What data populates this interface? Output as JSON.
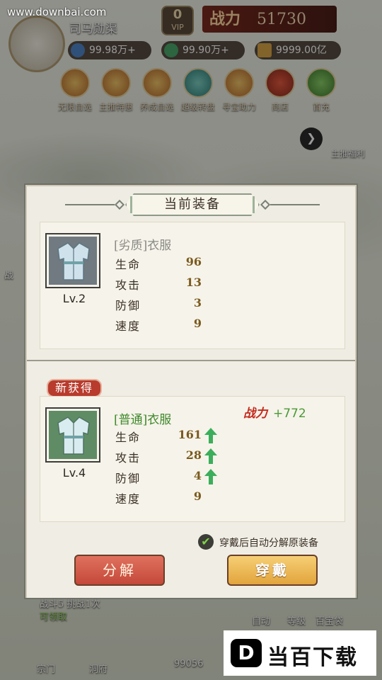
{
  "top_bar": {
    "site_watermark": "www.downbai.com",
    "player_name": "司马勋渠",
    "vip_label": "VIP",
    "vip_level": "0",
    "power_label": "战力",
    "power_value": "51730",
    "resources": [
      {
        "icon": "blue-gem-icon",
        "value": "99.98万+"
      },
      {
        "icon": "green-jade-icon",
        "value": "99.90万+"
      },
      {
        "icon": "scroll-icon",
        "value": "9999.00亿"
      }
    ]
  },
  "function_icons": [
    "无限自选",
    "主推特惠",
    "养成自选",
    "超级转盘",
    "寻宝助力",
    "商店",
    "首充"
  ],
  "side": {
    "arrow": "❯",
    "label": "主推福利"
  },
  "background_bottom": {
    "left_text_1": "战",
    "quest_text": "战斗5 挑战1次",
    "quest_status": "可领取",
    "nav_1": "宗门",
    "nav_2": "洞府",
    "counter": "99056",
    "right_1": "自动",
    "right_2": "等级",
    "right_3": "百宝袋"
  },
  "modal": {
    "title": "当前装备",
    "current": {
      "quality": "[劣质]",
      "name": "衣服",
      "level": "Lv.2",
      "stats": [
        {
          "label": "生命",
          "value": "96"
        },
        {
          "label": "攻击",
          "value": "13"
        },
        {
          "label": "防御",
          "value": "3"
        },
        {
          "label": "速度",
          "value": "9"
        }
      ]
    },
    "new_tag": "新获得",
    "new_item": {
      "quality": "[普通]",
      "name": "衣服",
      "level": "Lv.4",
      "power_label": "战力",
      "power_delta": "+772",
      "stats": [
        {
          "label": "生命",
          "value": "161",
          "up": true
        },
        {
          "label": "攻击",
          "value": "28",
          "up": true
        },
        {
          "label": "防御",
          "value": "4",
          "up": true
        },
        {
          "label": "速度",
          "value": "9",
          "up": false
        }
      ]
    },
    "auto_decompose_label": "穿戴后自动分解原装备",
    "auto_decompose_checked": true,
    "decompose_button": "分解",
    "equip_button": "穿戴"
  },
  "watermark": {
    "logo": "D",
    "text": "当百下载"
  },
  "colors": {
    "poor_quality": "#8a8a86",
    "normal_quality": "#3f8a2c",
    "stat_value": "#7a5a1e",
    "up_arrow": "#3cae5b",
    "power_red": "#c32a1c",
    "power_green": "#4a9a36"
  }
}
